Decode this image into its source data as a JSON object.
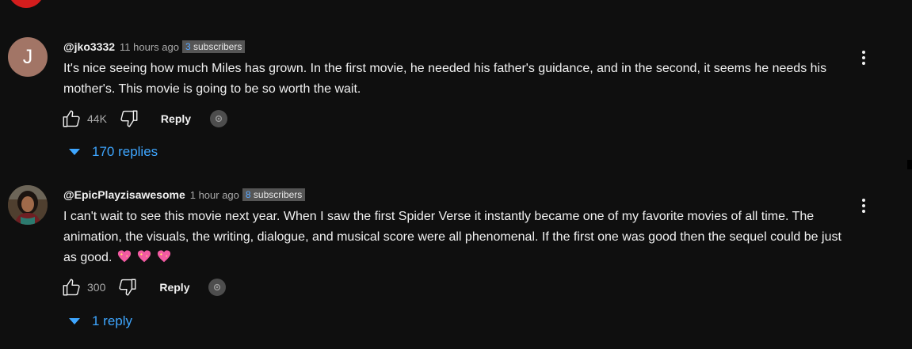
{
  "comments": [
    {
      "avatar_letter": "J",
      "handle": "@jko3332",
      "time": "11 hours ago",
      "subs_count": "3",
      "subs_label": " subscribers",
      "text": "It's nice seeing how much Miles has grown. In the first movie, he needed his father's guidance, and in the second, it seems he needs his mother's. This movie is going to be so worth the wait.",
      "likes": "44K",
      "reply_label": "Reply",
      "replies_label": "170 replies"
    },
    {
      "handle": "@EpicPlayzisawesome",
      "time": "1 hour ago",
      "subs_count": "8",
      "subs_label": " subscribers",
      "text": "I can't wait to see this movie next year. When I saw the first Spider Verse it instantly became one of my favorite movies of all time. The animation, the visuals, the writing, dialogue, and musical score were all phenomenal. If the first one was good then the sequel could be just as good.",
      "emojis": [
        "sparkling-heart",
        "sparkling-heart",
        "sparkling-heart"
      ],
      "likes": "300",
      "reply_label": "Reply",
      "replies_label": "1 reply"
    }
  ],
  "colors": {
    "background": "#0f0f0f",
    "text_primary": "#f1f1f1",
    "text_secondary": "#aaaaaa",
    "link_blue": "#3ea6ff",
    "badge_bg": "#555555",
    "avatar_j": "#a27566"
  },
  "icons": {
    "like": "thumb-up-icon",
    "dislike": "thumb-down-icon",
    "more": "three-dot-vertical-icon",
    "replies_toggle": "caret-down-icon",
    "creator_heart": "creator-reply-icon"
  }
}
